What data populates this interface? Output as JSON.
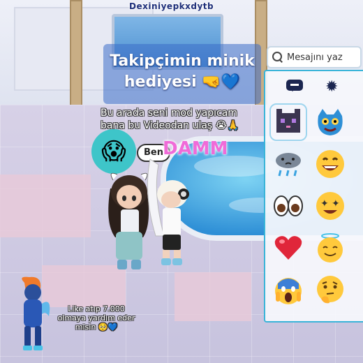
{
  "header": {
    "username": "Dexiniyepkxdytb",
    "title_line1": "Takipçimin minik",
    "title_line2": "hediyesi 🤜💙",
    "subtitle_line1": "Bu arada seni mod yapıcam",
    "subtitle_line2": "bana bu Videodan ulaş 😭🙏"
  },
  "scene": {
    "reaction_emoji": "😱",
    "name_tag": "Ben",
    "shout_text": "DAMM"
  },
  "chat_panel": {
    "search_placeholder": "Mesajını yaz",
    "tabs": [
      {
        "name": "chat-bubble-icon"
      },
      {
        "name": "spiky-bubble-icon"
      }
    ],
    "emotes": [
      "pixel-cat-icon",
      "blue-monster-icon",
      "rain-cloud-icon",
      "grinning-face-icon",
      "eyes-icon",
      "star-struck-face-icon",
      "red-heart-icon",
      "halo-face-icon",
      "screaming-face-icon",
      "thinking-face-icon"
    ]
  },
  "promo": {
    "line1": "Like atıp 7.000",
    "line2": "olmaya yardım eder",
    "line3": "misin 🥺💙"
  },
  "colors": {
    "panel_border": "#39b4d8",
    "title_bg": "#3c6ec8",
    "damm": "#f06bd8",
    "reaction_bubble": "#3ec5c9"
  }
}
